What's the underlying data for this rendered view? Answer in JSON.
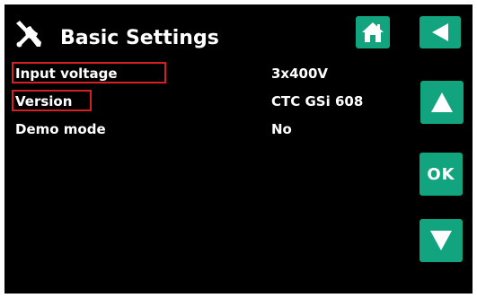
{
  "header": {
    "title": "Basic Settings",
    "icon": "tools-icon"
  },
  "nav": {
    "home_icon": "home-icon",
    "back_icon": "back-arrow-icon",
    "up_icon": "up-arrow-icon",
    "ok_label": "OK",
    "down_icon": "down-arrow-icon"
  },
  "settings": [
    {
      "label": "Input voltage",
      "value": "3x400V",
      "highlighted": true
    },
    {
      "label": "Version",
      "value": "CTC GSi 608",
      "highlighted": true
    },
    {
      "label": "Demo mode",
      "value": "No",
      "highlighted": false
    }
  ],
  "colors": {
    "background": "#000000",
    "button": "#12a37f",
    "text": "#ffffff",
    "highlight_border": "#d42020"
  }
}
